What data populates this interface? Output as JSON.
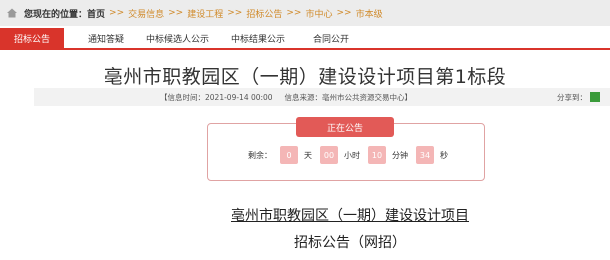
{
  "breadcrumb": {
    "prefix": "您现在的位置：",
    "home": "首页",
    "separator": ">>",
    "items": [
      "交易信息",
      "建设工程",
      "招标公告",
      "市中心",
      "市本级"
    ]
  },
  "tabs": [
    {
      "label": "招标公告",
      "active": true
    },
    {
      "label": "通知答疑",
      "active": false
    },
    {
      "label": "中标候选人公示",
      "active": false
    },
    {
      "label": "中标结果公示",
      "active": false
    },
    {
      "label": "合同公开",
      "active": false
    }
  ],
  "article": {
    "title": "亳州市职教园区（一期）建设设计项目第1标段",
    "info_time": "【信息时间：2021-09-14 00:00",
    "info_source": "信息来源：亳州市公共资源交易中心】",
    "share_label": "分享到："
  },
  "countdown": {
    "status": "正在公告",
    "remaining_label": "剩余：",
    "days": "0",
    "days_unit": "天",
    "hours": "00",
    "hours_unit": "小时",
    "minutes": "10",
    "minutes_unit": "分钟",
    "seconds": "34",
    "seconds_unit": "秒"
  },
  "document": {
    "heading": "亳州市职教园区（一期）建设设计项目",
    "subheading": "招标公告（网招）"
  },
  "colors": {
    "accent_red": "#d9342b",
    "breadcrumb_link": "#d08a2a",
    "share_green": "#3a9b3a"
  }
}
